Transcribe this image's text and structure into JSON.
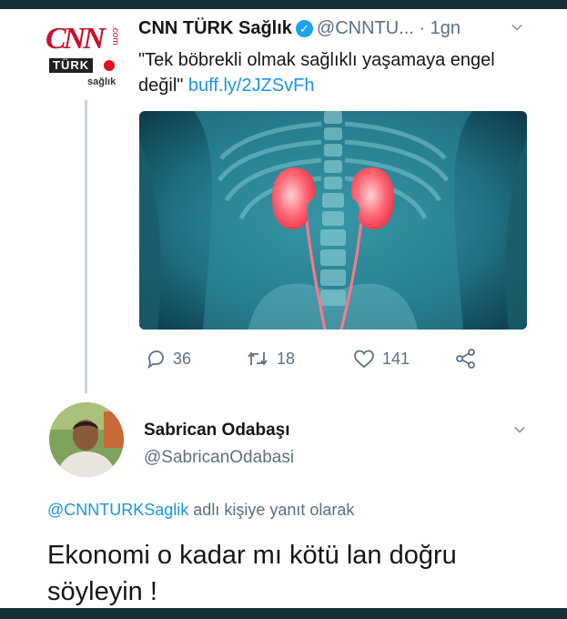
{
  "tweet": {
    "avatar": {
      "logo_text": "CNN",
      "logo_com": ".com",
      "logo_turk": "TÜRK",
      "logo_sub": "sağlık",
      "brand_red": "#c8102e"
    },
    "author_name": "CNN TÜRK Sağlık",
    "verified_icon": "verified-badge-icon",
    "handle": "@CNNTU...",
    "separator": " · ",
    "time": "1gn",
    "text": "\"Tek böbrekli olmak sağlıklı yaşamaya engel değil\"",
    "link": "buff.ly/2JZSvFh",
    "image_icon": "kidney-illustration",
    "stats": {
      "replies": "36",
      "retweets": "18",
      "likes": "141"
    },
    "action_icons": [
      "reply-icon",
      "retweet-icon",
      "like-icon",
      "share-icon"
    ]
  },
  "reply": {
    "author_name": "Sabrican Odabaşı",
    "handle": "@SabricanOdabasi",
    "replying_mention": "@CNNTURKSaglik",
    "replying_suffix": " adlı kişiye yanıt olarak",
    "text": "Ekonomi o kadar mı kötü lan doğru söyleyin !"
  },
  "colors": {
    "link": "#1b95e0",
    "secondary_text": "#5b7083",
    "frame": "#16303a"
  }
}
